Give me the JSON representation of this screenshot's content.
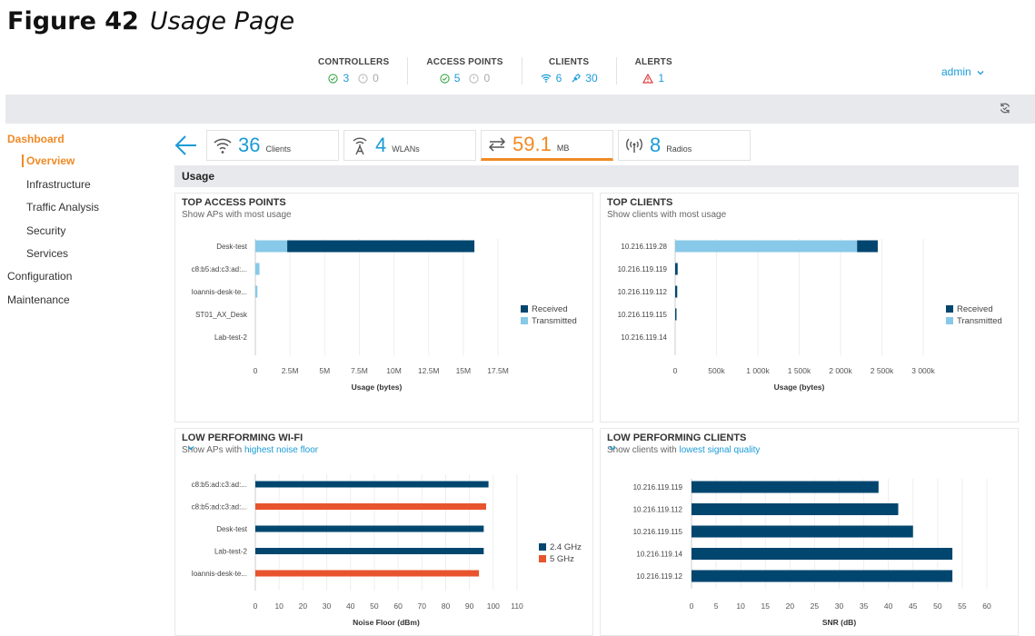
{
  "figure": {
    "label": "Figure 42",
    "caption": "Usage Page"
  },
  "header": {
    "stats": [
      {
        "label": "CONTROLLERS",
        "ok": "3",
        "off": "0"
      },
      {
        "label": "ACCESS POINTS",
        "ok": "5",
        "off": "0"
      },
      {
        "label": "CLIENTS",
        "wifi": "6",
        "wired": "30"
      },
      {
        "label": "ALERTS",
        "alerts": "1"
      }
    ],
    "user": "admin"
  },
  "sidebar": {
    "dashboard": "Dashboard",
    "overview": "Overview",
    "infrastructure": "Infrastructure",
    "traffic": "Traffic Analysis",
    "security": "Security",
    "services": "Services",
    "configuration": "Configuration",
    "maintenance": "Maintenance"
  },
  "tiles": [
    {
      "num": "36",
      "unit": "Clients",
      "icon": "wifi-icon"
    },
    {
      "num": "4",
      "unit": "WLANs",
      "icon": "antenna-icon"
    },
    {
      "num": "59.1",
      "unit": "MB",
      "icon": "transfer-icon"
    },
    {
      "num": "8",
      "unit": "Radios",
      "icon": "radio-icon"
    }
  ],
  "section": "Usage",
  "panels": {
    "top_aps": {
      "title": "TOP ACCESS POINTS",
      "subtitle": "Show APs with most usage"
    },
    "top_clients": {
      "title": "TOP CLIENTS",
      "subtitle": "Show clients with most usage"
    },
    "low_wifi": {
      "title": "LOW PERFORMING WI-FI",
      "subtitle_prefix": "Show APs with",
      "subtitle_link": "highest noise floor"
    },
    "low_clients": {
      "title": "LOW PERFORMING CLIENTS",
      "subtitle_prefix": "Show clients with",
      "subtitle_link": "lowest signal quality"
    }
  },
  "colors": {
    "received": "#00466f",
    "transmitted": "#88c8e8",
    "ghz24": "#00466f",
    "ghz5": "#e8542e",
    "accent": "#f08a24",
    "link": "#1a9bd7"
  },
  "chart_data": [
    {
      "type": "bar",
      "orientation": "horizontal",
      "stacked": true,
      "categories": [
        "Desk-test",
        "c8:b5:ad:c3:ad:...",
        "Ioannis-desk-te...",
        "ST01_AX_Desk",
        "Lab-test-2"
      ],
      "series": [
        {
          "name": "Transmitted",
          "values": [
            2300000,
            300000,
            150000,
            0,
            0
          ]
        },
        {
          "name": "Received",
          "values": [
            13500000,
            0,
            0,
            0,
            0
          ]
        }
      ],
      "xlabel": "Usage (bytes)",
      "xlim": [
        0,
        17500000
      ],
      "ticks": [
        "0",
        "2.5M",
        "5M",
        "7.5M",
        "10M",
        "12.5M",
        "15M",
        "17.5M"
      ],
      "legend": "right"
    },
    {
      "type": "bar",
      "orientation": "horizontal",
      "stacked": true,
      "categories": [
        "10.216.119.28",
        "10.216.119.119",
        "10.216.119.112",
        "10.216.119.115",
        "10.216.119.14"
      ],
      "series": [
        {
          "name": "Transmitted",
          "values": [
            2200000,
            0,
            0,
            0,
            0
          ]
        },
        {
          "name": "Received",
          "values": [
            250000,
            30000,
            25000,
            10000,
            0
          ]
        }
      ],
      "xlabel": "Usage (bytes)",
      "xlim": [
        0,
        3000000
      ],
      "ticks": [
        "0",
        "500k",
        "1 000k",
        "1 500k",
        "2 000k",
        "2 500k",
        "3 000k"
      ],
      "legend": "right"
    },
    {
      "type": "bar",
      "orientation": "horizontal",
      "grouped": true,
      "categories": [
        "c8:b5:ad:c3:ad:...",
        "c8:b5:ad:c3:ad:...",
        "Desk-test",
        "Lab-test-2",
        "Ioannis-desk-te..."
      ],
      "series": [
        {
          "name": "2.4 GHz",
          "values": [
            98,
            0,
            96,
            96,
            0
          ]
        },
        {
          "name": "5 GHz",
          "values": [
            0,
            97,
            0,
            0,
            94
          ]
        }
      ],
      "xlabel": "Noise Floor (dBm)",
      "xlim": [
        0,
        110
      ],
      "ticks": [
        "0",
        "10",
        "20",
        "30",
        "40",
        "50",
        "60",
        "70",
        "80",
        "90",
        "100",
        "110"
      ],
      "legend": "right"
    },
    {
      "type": "bar",
      "orientation": "horizontal",
      "categories": [
        "10.216.119.119",
        "10.216.119.112",
        "10.216.119.115",
        "10.216.119.14",
        "10.216.119.12"
      ],
      "series": [
        {
          "values": [
            38,
            42,
            45,
            53,
            53
          ]
        }
      ],
      "xlabel": "SNR (dB)",
      "xlim": [
        0,
        60
      ],
      "ticks": [
        "0",
        "5",
        "10",
        "15",
        "20",
        "25",
        "30",
        "35",
        "40",
        "45",
        "50",
        "55",
        "60"
      ]
    }
  ]
}
